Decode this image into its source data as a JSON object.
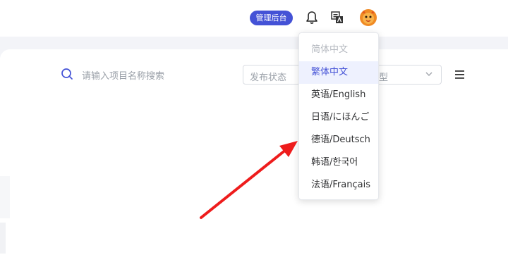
{
  "header": {
    "admin_label": "管理后台",
    "icons": [
      "bell-icon",
      "translate-icon",
      "avatar"
    ]
  },
  "toolbar": {
    "search_placeholder": "请输入项目名称搜索",
    "status_placeholder": "发布状态",
    "type_placeholder_visible": "型"
  },
  "language_menu": {
    "items": [
      {
        "label": "简体中文",
        "state": "disabled"
      },
      {
        "label": "繁体中文",
        "state": "selected"
      },
      {
        "label": "英语/English",
        "state": "normal"
      },
      {
        "label": "日语/にほんご",
        "state": "normal"
      },
      {
        "label": "德语/Deutsch",
        "state": "normal"
      },
      {
        "label": "韩语/한국어",
        "state": "normal"
      },
      {
        "label": "法语/Français",
        "state": "normal"
      }
    ]
  },
  "colors": {
    "accent": "#4452d6",
    "arrow": "#ee1c1c",
    "selected_bg": "#eef1fe"
  }
}
